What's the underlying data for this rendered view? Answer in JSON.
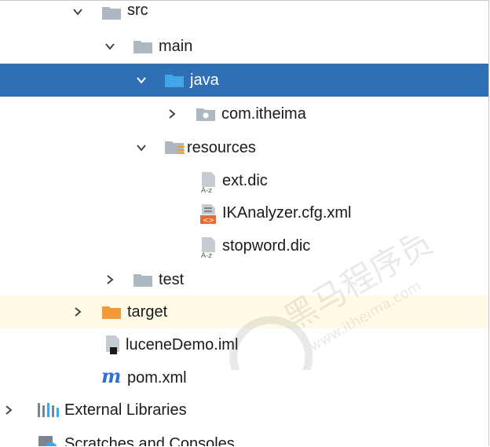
{
  "tree": {
    "src": {
      "label": "src"
    },
    "main": {
      "label": "main"
    },
    "java": {
      "label": "java"
    },
    "com_itheima": {
      "label": "com.itheima"
    },
    "resources": {
      "label": "resources"
    },
    "ext_dic": {
      "label": "ext.dic"
    },
    "ikanalyzer": {
      "label": "IKAnalyzer.cfg.xml"
    },
    "stopword": {
      "label": "stopword.dic"
    },
    "test": {
      "label": "test"
    },
    "target": {
      "label": "target"
    },
    "iml": {
      "label": "luceneDemo.iml"
    },
    "pom": {
      "label": "pom.xml",
      "icon_letter": "m"
    },
    "external_libraries": {
      "label": "External Libraries"
    },
    "scratches": {
      "label": "Scratches and Consoles"
    }
  },
  "colors": {
    "selection": "#2f6fb5",
    "target_row": "#fffbe6",
    "folder_gray": "#aeb8c3",
    "folder_blue": "#40a6e8",
    "folder_orange": "#f29a3a",
    "maven_blue": "#2f6fd8"
  },
  "watermark": {
    "brand": "黑马程序员",
    "site": "www.itheima.com"
  }
}
